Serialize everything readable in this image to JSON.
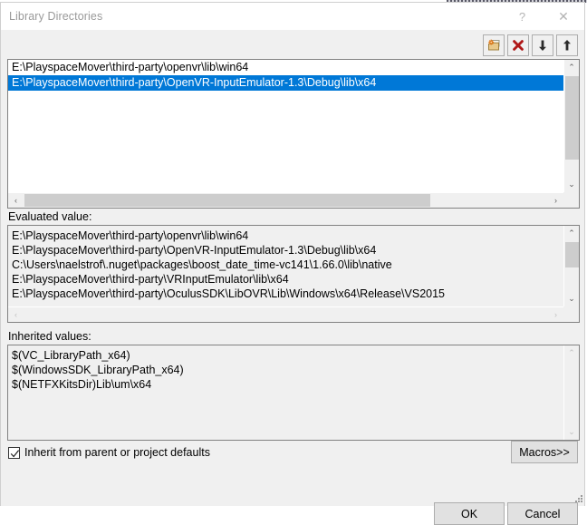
{
  "window": {
    "title": "Library Directories",
    "help_label": "?",
    "close_label": "✕"
  },
  "toolbar": {
    "new_line_icon": "new-folder-icon",
    "delete_icon": "delete-x-icon",
    "move_down_icon": "arrow-down-icon",
    "move_up_icon": "arrow-up-icon"
  },
  "directory_list": {
    "items": [
      {
        "path": "E:\\PlayspaceMover\\third-party\\openvr\\lib\\win64",
        "selected": false
      },
      {
        "path": "E:\\PlayspaceMover\\third-party\\OpenVR-InputEmulator-1.3\\Debug\\lib\\x64",
        "selected": true
      }
    ],
    "vscroll": {
      "up_arrow": "⌃",
      "down_arrow": "⌄"
    },
    "hscroll": {
      "left_arrow": "‹",
      "right_arrow": "›"
    }
  },
  "evaluated": {
    "label": "Evaluated value:",
    "lines": [
      "E:\\PlayspaceMover\\third-party\\openvr\\lib\\win64",
      "E:\\PlayspaceMover\\third-party\\OpenVR-InputEmulator-1.3\\Debug\\lib\\x64",
      "C:\\Users\\naelstrof\\.nuget\\packages\\boost_date_time-vc141\\1.66.0\\lib\\native",
      "E:\\PlayspaceMover\\third-party\\VRInputEmulator\\lib\\x64",
      "E:\\PlayspaceMover\\third-party\\OculusSDK\\LibOVR\\Lib\\Windows\\x64\\Release\\VS2015"
    ],
    "vscroll": {
      "up_arrow": "⌃",
      "down_arrow": "⌄"
    },
    "hscroll": {
      "left_arrow": "‹",
      "right_arrow": "›"
    }
  },
  "inherited": {
    "label": "Inherited values:",
    "lines": [
      "$(VC_LibraryPath_x64)",
      "$(WindowsSDK_LibraryPath_x64)",
      "$(NETFXKitsDir)Lib\\um\\x64"
    ],
    "vscroll": {
      "up_arrow": "⌃",
      "down_arrow": "⌄"
    }
  },
  "inherit_checkbox": {
    "label": "Inherit from parent or project defaults",
    "checked": true
  },
  "buttons": {
    "macros": "Macros>>",
    "ok": "OK",
    "cancel": "Cancel"
  },
  "colors": {
    "selection_blue": "#0078d7",
    "dialog_face": "#f0f0f0",
    "field_white": "#ffffff",
    "border_gray": "#828282",
    "scrollbar_thumb": "#cdcdcd"
  }
}
